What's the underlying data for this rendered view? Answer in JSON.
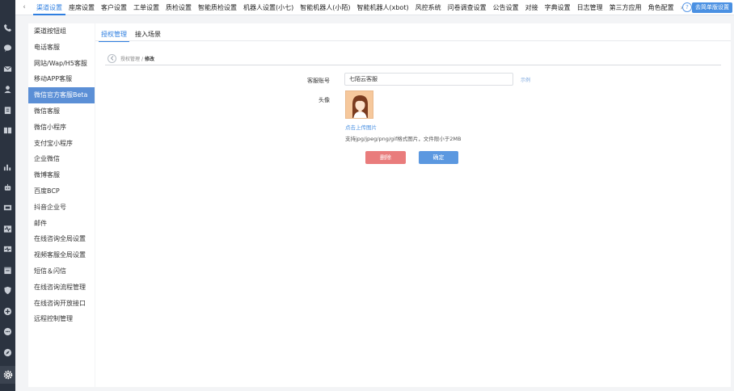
{
  "topnav": {
    "tabs": [
      "渠道设置",
      "座席设置",
      "客户设置",
      "工单设置",
      "质检设置",
      "智能质检设置",
      "机器人设置(小七)",
      "智能机器人(小陌)",
      "智能机器人(xbot)",
      "风控系统",
      "问卷调查设置",
      "公告设置",
      "对接",
      "字典设置",
      "日志管理",
      "第三方应用",
      "角色配置"
    ],
    "more": "›",
    "help": "?",
    "setting_button": "去简单版设置"
  },
  "sidebar": {
    "items": [
      "渠道按钮组",
      "电话客服",
      "网站/Wap/H5客服",
      "移动APP客服",
      "微信官方客服Beta",
      "微信客服",
      "微信小程序",
      "支付宝小程序",
      "企业微信",
      "微博客服",
      "百度BCP",
      "抖音企业号",
      "邮件",
      "在线咨询全局设置",
      "视频客服全局设置",
      "短信＆闪信",
      "在线咨询流程管理",
      "在线咨询开放接口",
      "远程控制管理"
    ],
    "active_index": 4
  },
  "main": {
    "tabs": [
      "授权管理",
      "接入场景"
    ],
    "active_tab": 0,
    "breadcrumb": {
      "parent": "授权管理",
      "separator": "/",
      "current": "修改"
    },
    "form": {
      "account_label": "客服账号",
      "account_value": "七陌云客服",
      "demo_link": "示例",
      "avatar_label": "头像",
      "upload_link": "点击上传图片",
      "upload_hint": "支持jpg/jpeg/png/gif格式图片，文件限小于2MB",
      "delete_button": "删除",
      "confirm_button": "确定"
    }
  },
  "colors": {
    "accent": "#2f7fe0",
    "sidebar_active": "#5b8fd6",
    "rail": "#2b3340",
    "delete": "#e97c7c",
    "confirm": "#5b98e0"
  },
  "rail_icons": [
    "phone-icon",
    "chat-bubble-icon",
    "mail-icon",
    "user-icon",
    "clipboard-icon",
    "book-icon",
    "bar-chart-icon",
    "robot-icon",
    "monitor-icon",
    "wave-icon",
    "heart-monitor-icon",
    "calendar-icon",
    "shield-icon",
    "plus-circle-icon",
    "message-icon",
    "compass-icon",
    "gear-icon"
  ]
}
